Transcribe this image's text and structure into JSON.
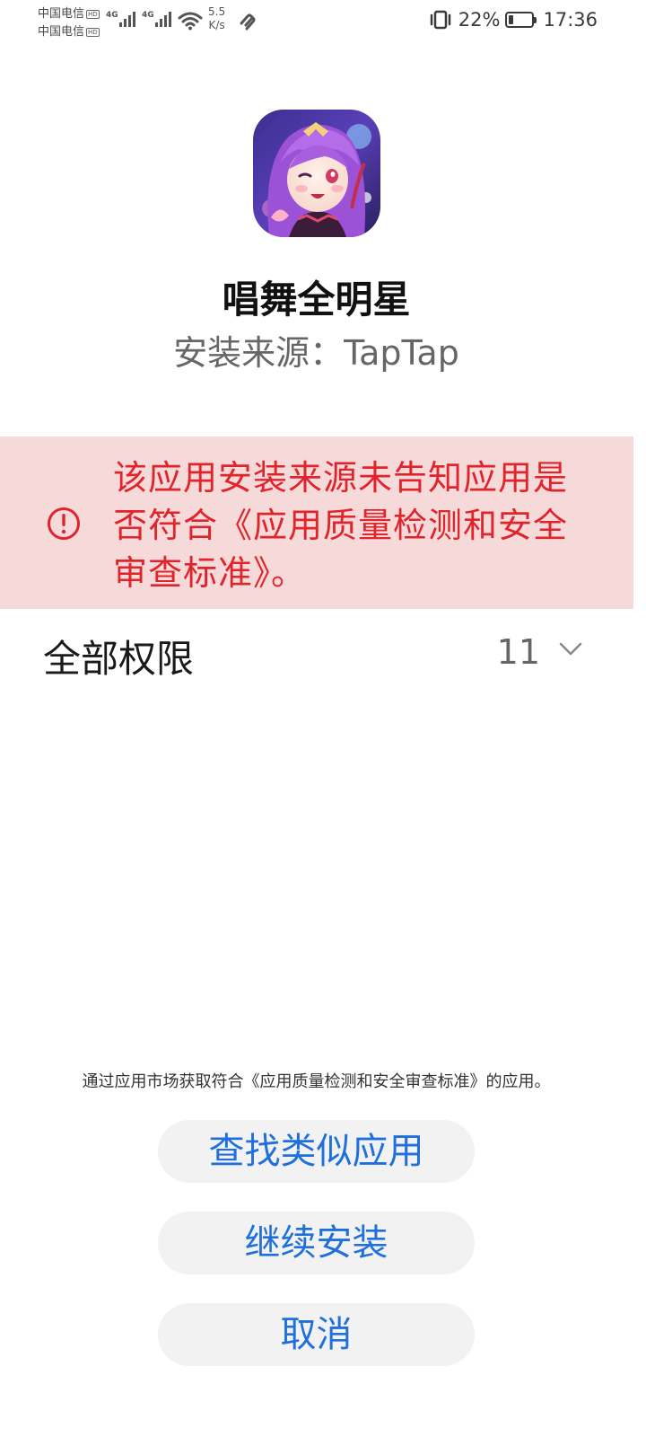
{
  "status_bar": {
    "carrier_1": "中国电信",
    "carrier_2": "中国电信",
    "hd_badge": "HD",
    "network_1": "4G",
    "network_2": "4G",
    "speed_value": "5.5",
    "speed_unit": "K/s",
    "battery_percent": "22%",
    "battery_level": 0.22,
    "time": "17:36"
  },
  "app": {
    "name": "唱舞全明星",
    "install_source": "安装来源：TapTap"
  },
  "warning": {
    "text": "该应用安装来源未告知应用是否符合《应用质量检测和安全审查标准》。"
  },
  "permissions": {
    "label": "全部权限",
    "count": "11"
  },
  "footer": {
    "note": "通过应用市场获取符合《应用质量检测和安全审查标准》的应用。",
    "find_similar_label": "查找类似应用",
    "continue_label": "继续安装",
    "cancel_label": "取消"
  },
  "colors": {
    "warning_background": "#f6d9d9",
    "warning_text": "#e0242c",
    "button_text": "#1f6fdc",
    "button_background": "#f2f2f2"
  },
  "icons": [
    "signal-icon",
    "wifi-icon",
    "link-icon",
    "vibrate-icon",
    "battery-icon",
    "alert-circle-icon",
    "chevron-down-icon"
  ]
}
